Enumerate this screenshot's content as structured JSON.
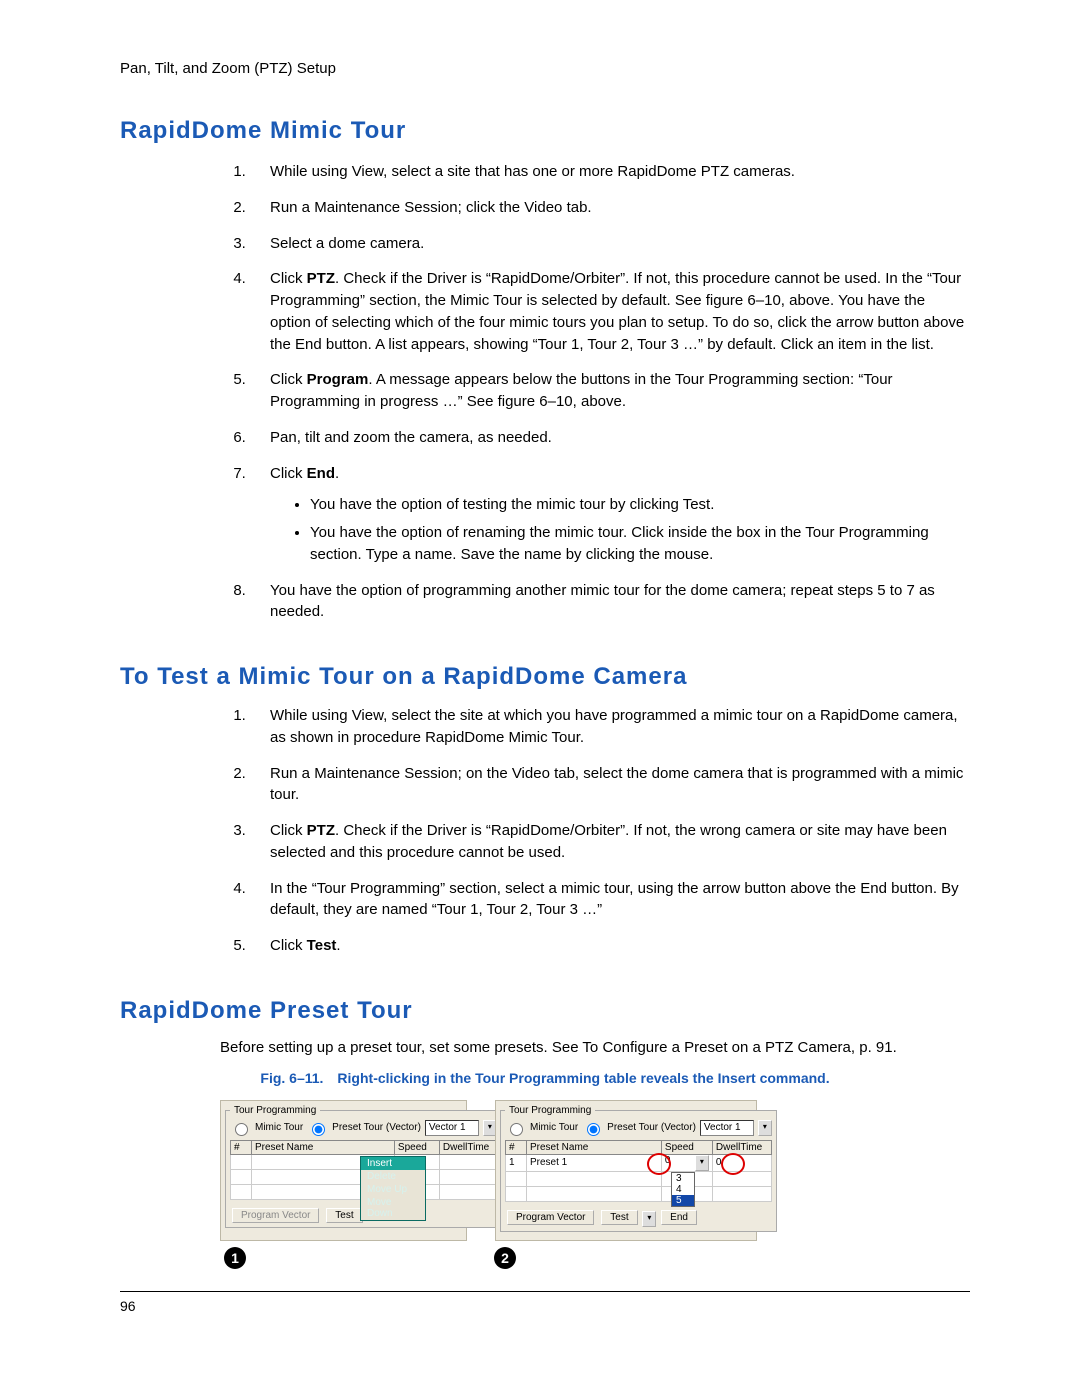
{
  "breadcrumb": "Pan, Tilt, and Zoom (PTZ) Setup",
  "headings": {
    "h1": "RapidDome Mimic Tour",
    "h2": "To Test a Mimic Tour on a RapidDome Camera",
    "h3": "RapidDome Preset Tour"
  },
  "mimic_steps": {
    "s1": "While using View, select a site that has one or more RapidDome PTZ cameras.",
    "s2": "Run a Maintenance Session; click the Video tab.",
    "s3": "Select a dome camera.",
    "s4_pre": "Click ",
    "s4_kw": "PTZ",
    "s4_post": ". Check if the Driver is “RapidDome/Orbiter”. If not, this procedure cannot be used. In the “Tour Programming” section, the Mimic Tour is selected by default. See figure 6–10, above. You have the option of selecting which of the four mimic tours you plan to setup. To do so, click the arrow button above the End button. A list appears, showing “Tour 1, Tour 2, Tour 3 …” by default. Click an item in the list.",
    "s5_pre": "Click ",
    "s5_kw": "Program",
    "s5_post": ". A message appears below the buttons in the Tour Programming section: “Tour Programming in progress …” See figure 6–10, above.",
    "s6": "Pan, tilt and zoom the camera, as needed.",
    "s7_pre": "Click ",
    "s7_kw": "End",
    "s7_post": ".",
    "s7b1": "You have the option of testing the mimic tour by clicking Test.",
    "s7b2": "You have the option of renaming the mimic tour. Click inside the box in the Tour Programming section. Type a name. Save the name by clicking the mouse.",
    "s8": "You have the option of programming another mimic tour for the dome camera; repeat steps 5 to 7 as needed."
  },
  "test_steps": {
    "s1": "While using View, select the site at which you have programmed a mimic tour on a RapidDome camera, as shown in procedure RapidDome Mimic Tour.",
    "s2": "Run a Maintenance Session; on the Video tab, select the dome camera that is programmed with a mimic tour.",
    "s3_pre": "Click ",
    "s3_kw": "PTZ",
    "s3_post": ". Check if the Driver is “RapidDome/Orbiter”. If not, the wrong camera or site may have been selected and this procedure cannot be used.",
    "s4": "In the “Tour Programming” section, select a mimic tour, using the arrow button above the End button. By default, they are named “Tour 1, Tour 2, Tour 3 …”",
    "s5_pre": "Click ",
    "s5_kw": "Test",
    "s5_post": "."
  },
  "preset_intro": "Before setting up a preset tour, set some presets. See To Configure a Preset on a PTZ Camera, p. 91.",
  "fig_caption": "Fig. 6–11. Right-clicking in the Tour Programming table reveals the Insert command.",
  "panel": {
    "legend": "Tour Programming",
    "mimic_label": "Mimic Tour",
    "preset_label": "Preset Tour (Vector)",
    "vector_value": "Vector 1",
    "col_num": "#",
    "col_preset": "Preset Name",
    "col_speed": "Speed",
    "col_dwell": "DwellTime",
    "row1_num": "1",
    "row1_preset": "Preset 1",
    "row1_speed": "0",
    "row1_dwell": "0",
    "ctx_insert": "Insert",
    "ctx_delete": "Delete",
    "ctx_moveup": "Move Up",
    "ctx_movedown": "Move Down",
    "btn_program": "Program Vector",
    "btn_test": "Test",
    "btn_end": "End",
    "speed_opts": {
      "o3": "3",
      "o4": "4",
      "o5": "5"
    }
  },
  "bullets": {
    "one": "1",
    "two": "2"
  },
  "page_number": "96"
}
